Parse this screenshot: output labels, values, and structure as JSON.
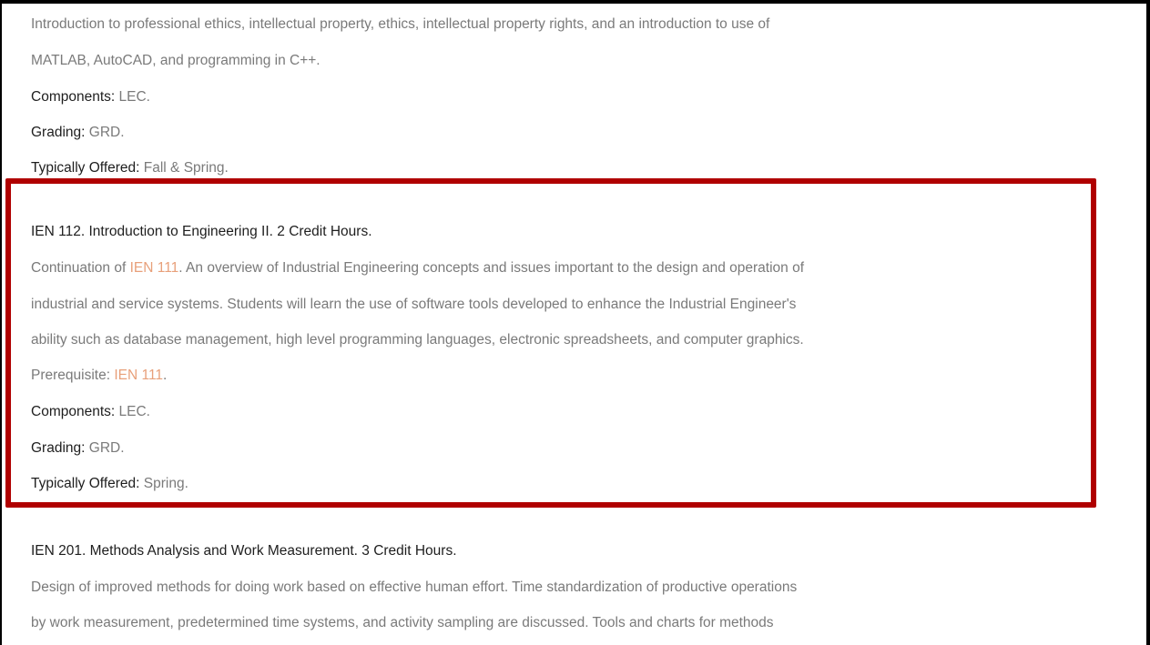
{
  "highlight_color": "#b00000",
  "link_color": "#e8a07a",
  "prev_course": {
    "description_line1": "Introduction to professional ethics, intellectual property, ethics, intellectual property rights, and an introduction to use of",
    "description_line2": "MATLAB, AutoCAD, and programming in C++.",
    "components_label": "Components:",
    "components_value": " LEC.",
    "grading_label": "Grading:",
    "grading_value": " GRD.",
    "offered_label": "Typically Offered:",
    "offered_value": " Fall & Spring."
  },
  "highlighted_course": {
    "title": "IEN 112. Introduction to Engineering II. 2 Credit Hours.",
    "desc_prefix": "Continuation of ",
    "desc_link": "IEN 111",
    "desc_line1_rest": ". An overview of Industrial Engineering concepts and issues important to the design and operation of",
    "desc_line2": "industrial and service systems. Students will learn the use of software tools developed to enhance the Industrial Engineer's",
    "desc_line3": "ability such as database management, high level programming languages, electronic spreadsheets, and computer graphics.",
    "prereq_label": "Prerequisite: ",
    "prereq_link": "IEN 111",
    "prereq_end": ".",
    "components_label": "Components:",
    "components_value": " LEC.",
    "grading_label": "Grading:",
    "grading_value": " GRD.",
    "offered_label": "Typically Offered:",
    "offered_value": " Spring."
  },
  "next_course": {
    "title": "IEN 201. Methods Analysis and Work Measurement. 3 Credit Hours.",
    "description_line1": "Design of improved methods for doing work based on effective human effort. Time standardization of productive operations",
    "description_line2": "by work measurement, predetermined time systems, and activity sampling are discussed. Tools and charts for methods"
  }
}
